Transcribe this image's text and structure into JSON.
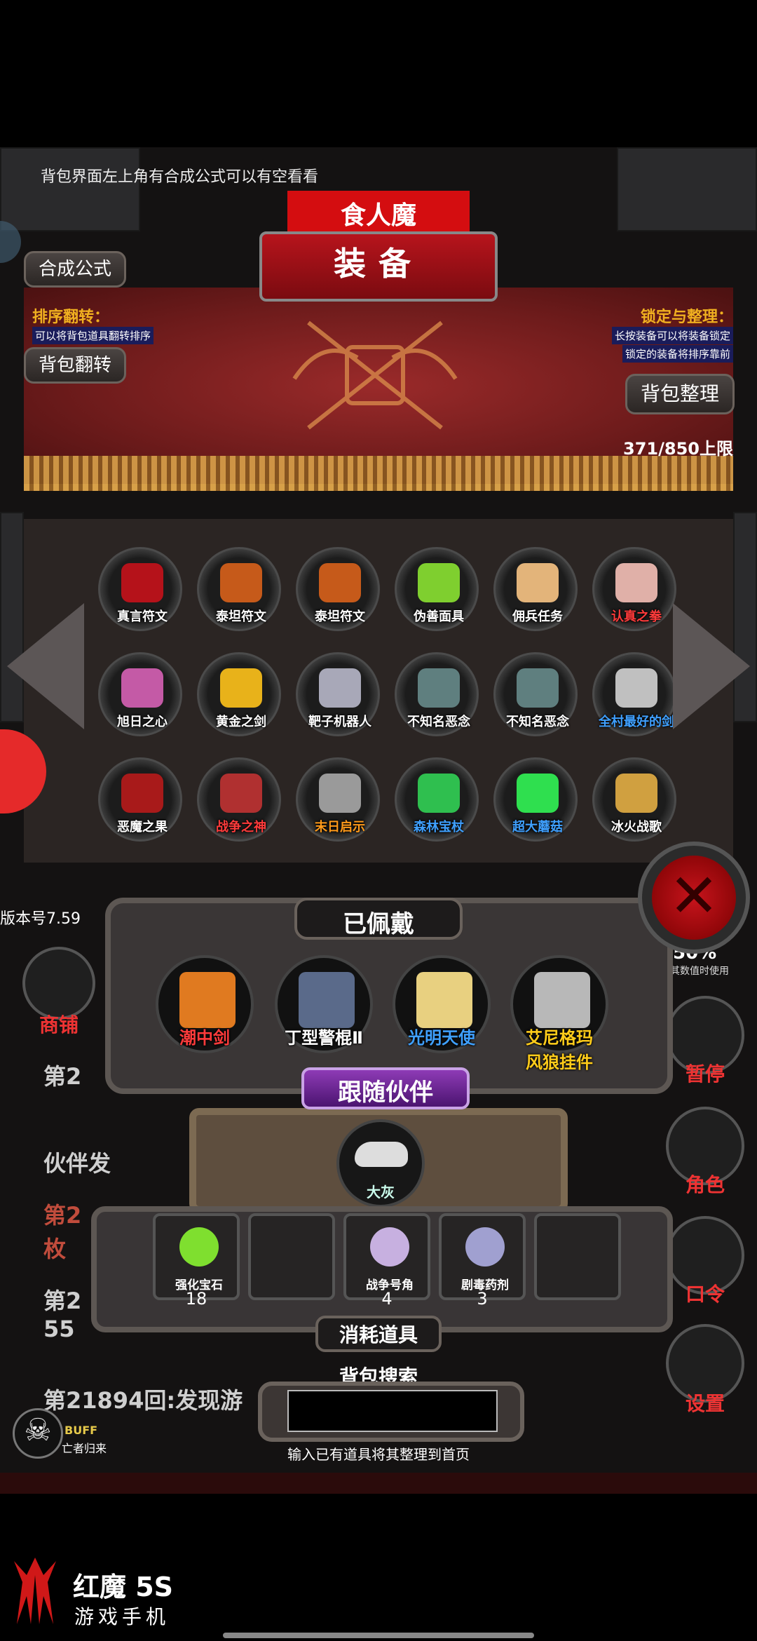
{
  "hint": "背包界面左上角有合成公式可以有空看看",
  "boss_name": "食人魔",
  "title": "装备",
  "buttons": {
    "formula": "合成公式",
    "flip": "背包翻转",
    "sort": "背包整理"
  },
  "sort_info": {
    "title": "排序翻转：",
    "desc": "可以将背包道具翻转排序"
  },
  "lock_info": {
    "title": "锁定与整理：",
    "desc1": "长按装备可以将装备锁定",
    "desc2": "锁定的装备将排序靠前"
  },
  "capacity": "371/850上限",
  "inventory": [
    {
      "name": "真言符文",
      "color": "#ffffff",
      "icon_color": "#b5121a"
    },
    {
      "name": "泰坦符文",
      "color": "#ffffff",
      "icon_color": "#c65a1a"
    },
    {
      "name": "泰坦符文",
      "color": "#ffffff",
      "icon_color": "#c65a1a"
    },
    {
      "name": "伪善面具",
      "color": "#ffffff",
      "icon_color": "#7fcf2f"
    },
    {
      "name": "佣兵任务",
      "color": "#ffffff",
      "icon_color": "#e3b47a"
    },
    {
      "name": "认真之拳",
      "color": "#ff3b3b",
      "icon_color": "#e0b0a8"
    },
    {
      "name": "旭日之心",
      "color": "#ffffff",
      "icon_color": "#c45aa6"
    },
    {
      "name": "黄金之剑",
      "color": "#ffffff",
      "icon_color": "#e8b21a"
    },
    {
      "name": "靶子机器人",
      "color": "#ffffff",
      "icon_color": "#a8a8b8"
    },
    {
      "name": "不知名恶念",
      "color": "#ffffff",
      "icon_color": "#5f7f7f"
    },
    {
      "name": "不知名恶念",
      "color": "#ffffff",
      "icon_color": "#5f7f7f"
    },
    {
      "name": "全村最好的剑",
      "color": "#3fa0ff",
      "icon_color": "#c0c0c0"
    },
    {
      "name": "恶魔之果",
      "color": "#ffffff",
      "icon_color": "#a81a1a"
    },
    {
      "name": "战争之神",
      "color": "#ff3b3b",
      "icon_color": "#b03030"
    },
    {
      "name": "末日启示",
      "color": "#ff9a1a",
      "icon_color": "#9a9a9a"
    },
    {
      "name": "森林宝杖",
      "color": "#3fa0ff",
      "icon_color": "#2fbf4f"
    },
    {
      "name": "超大蘑菇",
      "color": "#3fa0ff",
      "icon_color": "#2fdf4f"
    },
    {
      "name": "冰火战歌",
      "color": "#ffffff",
      "icon_color": "#d0a040"
    }
  ],
  "version": "版本号7.59",
  "underlying": {
    "line1": "第2",
    "line2": "伙伴发",
    "line3a": "第2",
    "line3b": "枚",
    "line4a": "第2",
    "line4b": "55",
    "line5": "第21894回:发现游"
  },
  "side_buttons": {
    "shop": "商铺",
    "stat_small": "50%",
    "stat_caption": "其数值时使用",
    "pause": "暂停",
    "role": "角色",
    "code": "口令",
    "settings": "设置"
  },
  "equipped": {
    "title": "已佩戴",
    "items": [
      {
        "name": "潮中剑",
        "color": "#ff3b3b",
        "icon_color": "#e07a20"
      },
      {
        "name": "丁型警棍Ⅱ",
        "color": "#ffffff",
        "icon_color": "#5a6a8a"
      },
      {
        "name": "光明天使",
        "color": "#3fa0ff",
        "icon_color": "#e8d080"
      },
      {
        "name": "艾尼格玛\n风狼挂件",
        "color": "#ffcc1a",
        "icon_color": "#b8b8b8"
      }
    ]
  },
  "follow": {
    "title": "跟随伙伴",
    "pet_name": "大灰"
  },
  "consumables": {
    "title": "消耗道具",
    "items": [
      {
        "name": "强化宝石",
        "count": "18",
        "icon_color": "#7fdf2f"
      },
      {
        "name": "",
        "count": "",
        "icon_color": ""
      },
      {
        "name": "战争号角",
        "count": "4",
        "icon_color": "#c7b0e0"
      },
      {
        "name": "剧毒药剂",
        "count": "3",
        "icon_color": "#a0a0d0"
      },
      {
        "name": "",
        "count": "",
        "icon_color": ""
      }
    ]
  },
  "search": {
    "title": "背包搜索",
    "value": "",
    "hint": "输入已有道具将其整理到首页"
  },
  "buff": {
    "label": "BUFF",
    "name": "亡者归来"
  },
  "brand": {
    "name": "红魔 5S",
    "sub": "游戏手机"
  }
}
